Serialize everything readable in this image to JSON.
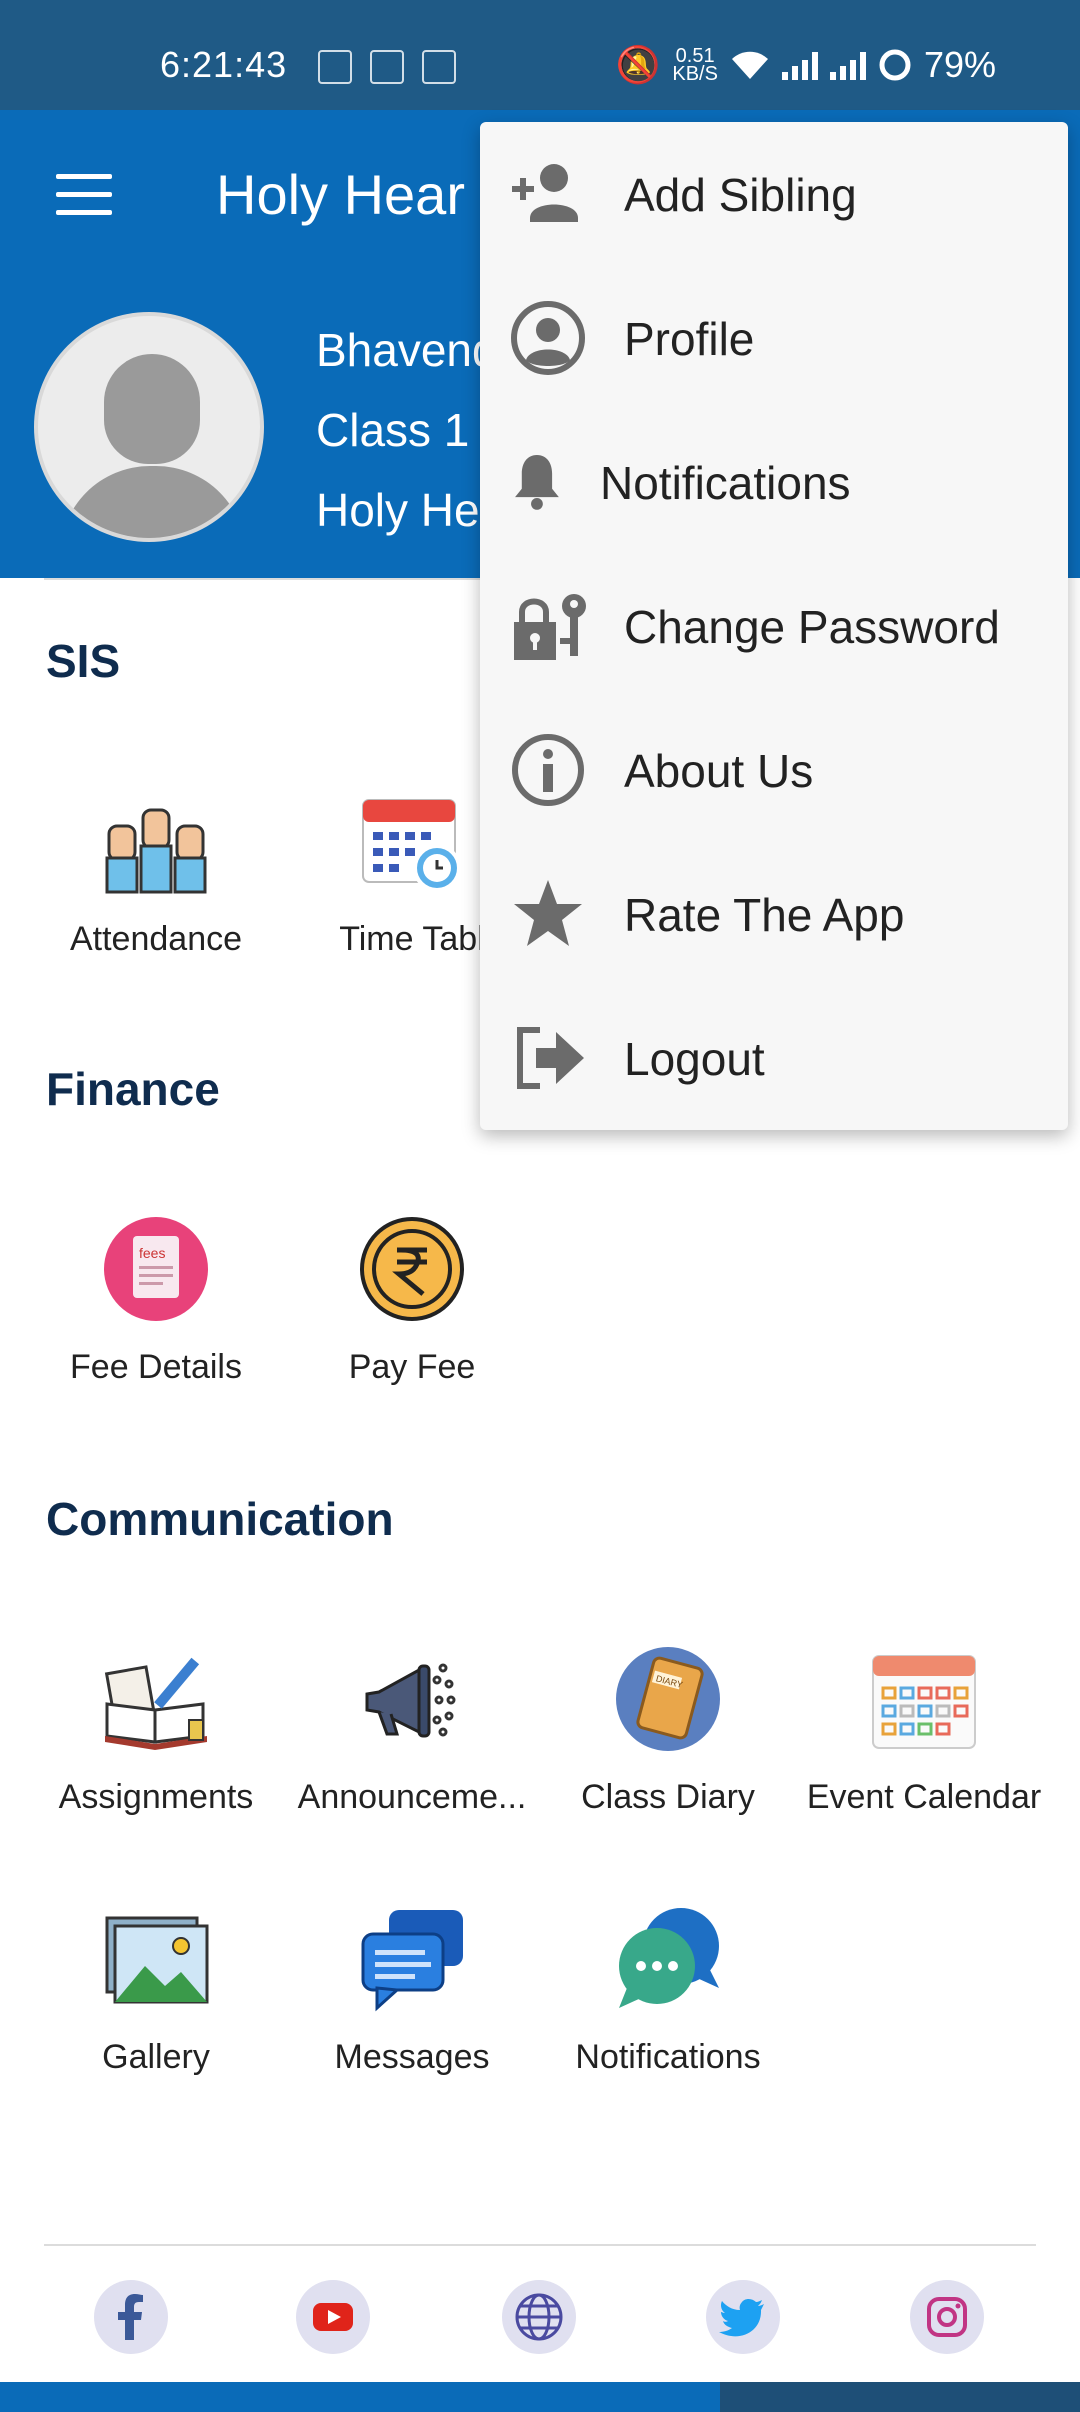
{
  "status": {
    "time": "6:21:43",
    "net_speed_top": "0.51",
    "net_speed_bottom": "KB/S",
    "battery": "79%"
  },
  "header": {
    "title": "Holy Hear",
    "student_name": "Bhavend",
    "class": "Class 1",
    "school": "Holy He"
  },
  "menu": {
    "items": [
      {
        "label": "Add Sibling",
        "icon": "add-person-icon"
      },
      {
        "label": "Profile",
        "icon": "profile-icon"
      },
      {
        "label": "Notifications",
        "icon": "bell-icon"
      },
      {
        "label": "Change Password",
        "icon": "lock-key-icon"
      },
      {
        "label": "About Us",
        "icon": "info-icon"
      },
      {
        "label": "Rate The App",
        "icon": "star-icon"
      },
      {
        "label": "Logout",
        "icon": "logout-icon"
      }
    ]
  },
  "sections": {
    "sis": {
      "title": "SIS",
      "items": [
        {
          "label": "Attendance",
          "icon": "raised-hands-icon"
        },
        {
          "label": "Time Tabl",
          "icon": "timetable-calendar-icon"
        }
      ]
    },
    "finance": {
      "title": "Finance",
      "items": [
        {
          "label": "Fee Details",
          "icon": "fees-doc-icon"
        },
        {
          "label": "Pay Fee",
          "icon": "rupee-coin-icon"
        }
      ]
    },
    "communication": {
      "title": "Communication",
      "items": [
        {
          "label": "Assignments",
          "icon": "book-pencil-icon"
        },
        {
          "label": "Announceme...",
          "icon": "megaphone-icon"
        },
        {
          "label": "Class Diary",
          "icon": "diary-icon"
        },
        {
          "label": "Event Calendar",
          "icon": "event-calendar-icon"
        },
        {
          "label": "Gallery",
          "icon": "gallery-image-icon"
        },
        {
          "label": "Messages",
          "icon": "chat-bubbles-icon"
        },
        {
          "label": "Notifications",
          "icon": "chat-notification-icon"
        }
      ]
    }
  },
  "social": [
    "facebook-icon",
    "youtube-icon",
    "globe-icon",
    "twitter-icon",
    "instagram-icon"
  ],
  "colors": {
    "primary": "#0a6bb8",
    "status_bar": "#1f5a86",
    "section_title": "#0f2c4e",
    "menu_bg": "#f7f7f7"
  }
}
